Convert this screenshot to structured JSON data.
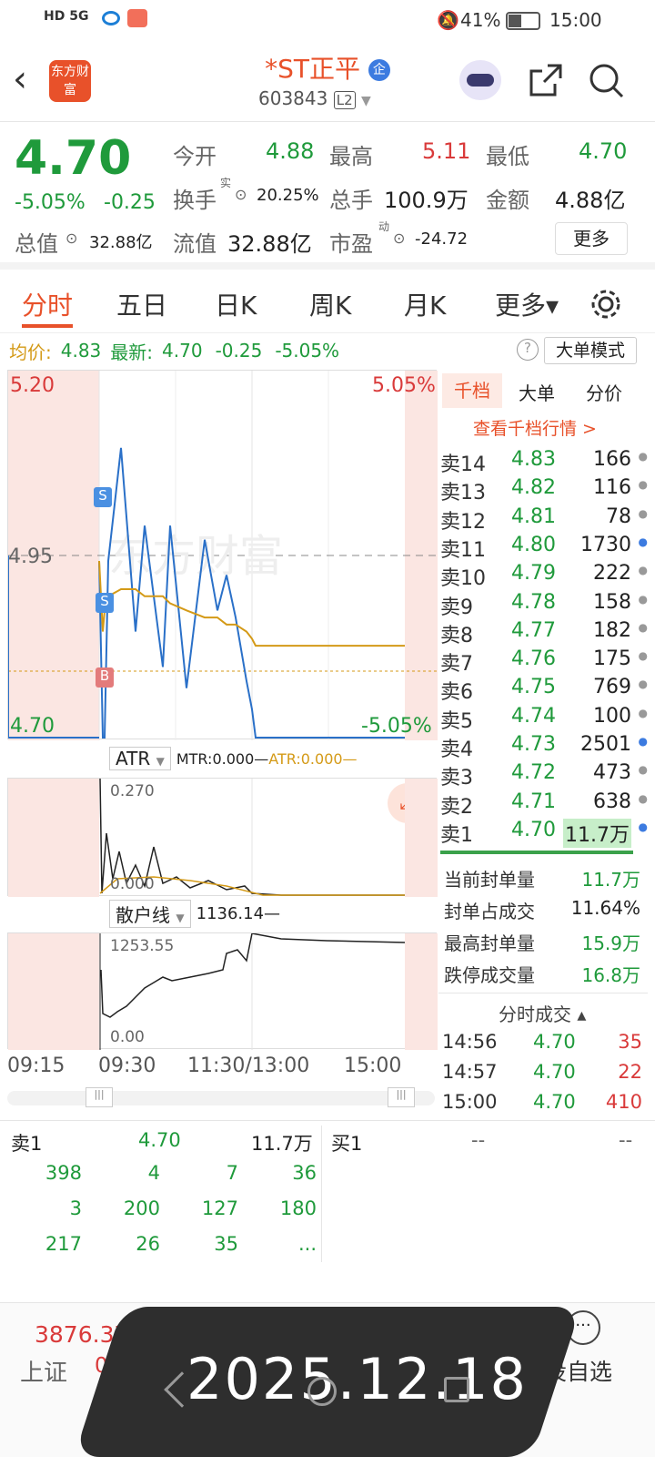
{
  "status_bar": {
    "icons_left": "HD 5G",
    "battery": "41%",
    "time": "15:00"
  },
  "header": {
    "logo": "东方财富",
    "name": "*ST正平",
    "code": "603843",
    "level": "L2",
    "badge": "企"
  },
  "quote": {
    "price": "4.70",
    "pct": "-5.05%",
    "chg": "-0.25",
    "open_label": "今开",
    "open": "4.88",
    "high_label": "最高",
    "high": "5.11",
    "low_label": "最低",
    "low": "4.70",
    "turnover_label": "换手",
    "turnover_sup": "实",
    "turnover": "20.25%",
    "volume_label": "总手",
    "volume": "100.9万",
    "amount_label": "金额",
    "amount": "4.88亿",
    "mcap_label": "总值",
    "mcap": "32.88亿",
    "float_label": "流值",
    "float": "32.88亿",
    "pe_label": "市盈",
    "pe_sup": "动",
    "pe": "-24.72",
    "more": "更多"
  },
  "tabs": [
    "分时",
    "五日",
    "日K",
    "周K",
    "月K",
    "更多▾"
  ],
  "legend": {
    "avg_label": "均价:",
    "avg": "4.83",
    "new_label": "最新:",
    "new": "4.70",
    "chg": "-0.25",
    "pct": "-5.05%",
    "mode": "大单模式"
  },
  "chart": {
    "y_top": "5.20",
    "y_top_pct": "5.05%",
    "y_bot": "4.70",
    "y_bot_pct": "-5.05%",
    "y_mid": "4.95",
    "watermark": "东方财富",
    "marker_s": "S",
    "marker_b": "B",
    "atr_label": "ATR",
    "atr_line": "MTR:0.000—",
    "atr_line2": "ATR:0.000—",
    "atr_top": "0.270",
    "atr_bot": "0.000",
    "retail_label": "散户线",
    "retail_val": "1136.14—",
    "retail_top": "1253.55",
    "retail_bot": "0.00",
    "times": [
      "09:15",
      "09:30",
      "11:30/13:00",
      "15:00"
    ]
  },
  "depth": {
    "tabs": [
      "千档",
      "大单",
      "分价"
    ],
    "link": "查看千档行情 >",
    "asks": [
      [
        "卖14",
        "4.83",
        "166"
      ],
      [
        "卖13",
        "4.82",
        "116"
      ],
      [
        "卖12",
        "4.81",
        "78"
      ],
      [
        "卖11",
        "4.80",
        "1730"
      ],
      [
        "卖10",
        "4.79",
        "222"
      ],
      [
        "卖9",
        "4.78",
        "158"
      ],
      [
        "卖8",
        "4.77",
        "182"
      ],
      [
        "卖7",
        "4.76",
        "175"
      ],
      [
        "卖6",
        "4.75",
        "769"
      ],
      [
        "卖5",
        "4.74",
        "100"
      ],
      [
        "卖4",
        "4.73",
        "2501"
      ],
      [
        "卖3",
        "4.72",
        "473"
      ],
      [
        "卖2",
        "4.71",
        "638"
      ],
      [
        "卖1",
        "4.70",
        "11.7万"
      ]
    ],
    "stats": [
      [
        "当前封单量",
        "11.7万"
      ],
      [
        "封单占成交",
        "11.64%"
      ],
      [
        "最高封单量",
        "15.9万"
      ],
      [
        "跌停成交量",
        "16.8万"
      ]
    ],
    "ticks_title": "分时成交 ▴",
    "ticks": [
      [
        "14:56",
        "4.70",
        "35"
      ],
      [
        "14:57",
        "4.70",
        "22"
      ],
      [
        "15:00",
        "4.70",
        "410"
      ]
    ]
  },
  "level1": {
    "sell_label": "卖1",
    "sell_price": "4.70",
    "sell_vol": "11.7万",
    "buy_label": "买1",
    "buy_price": "--",
    "buy_vol": "--",
    "queue": [
      [
        "398",
        "4",
        "7",
        "36"
      ],
      [
        "3",
        "200",
        "127",
        "180"
      ],
      [
        "217",
        "26",
        "35",
        "..."
      ]
    ]
  },
  "bottom": {
    "index": "3876.37",
    "index_name": "上证",
    "index_pct": "0.16%",
    "nav_last": "设自选",
    "date": "2025.12.18"
  },
  "chart_data": {
    "type": "line",
    "ylim": [
      4.7,
      5.2
    ],
    "ref_price": 4.95,
    "series": [
      {
        "name": "price",
        "values": [
          4.95,
          4.7,
          4.7,
          4.95,
          5.11,
          4.85,
          5.0,
          4.9,
          4.8,
          5.0,
          4.77,
          4.98,
          4.88,
          4.93,
          4.87,
          4.78,
          4.74,
          4.7,
          4.7,
          4.7
        ]
      },
      {
        "name": "avg",
        "values": [
          4.95,
          4.85,
          4.88,
          4.9,
          4.91,
          4.91,
          4.9,
          4.9,
          4.9,
          4.89,
          4.88,
          4.87,
          4.87,
          4.86,
          4.86,
          4.85,
          4.84,
          4.83,
          4.83,
          4.83
        ]
      }
    ]
  }
}
